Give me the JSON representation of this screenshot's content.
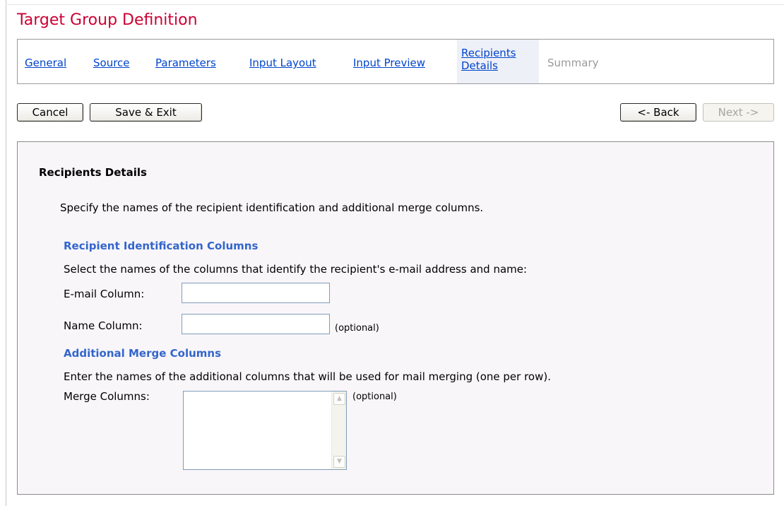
{
  "page": {
    "title": "Target Group Definition"
  },
  "tabs": [
    {
      "label": "General",
      "state": "link"
    },
    {
      "label": "Source",
      "state": "link"
    },
    {
      "label": "Parameters",
      "state": "link"
    },
    {
      "label": "Input Layout",
      "state": "link"
    },
    {
      "label": "Input Preview",
      "state": "link"
    },
    {
      "label_line1": "Recipients",
      "label_line2": "Details",
      "state": "active"
    },
    {
      "label": "Summary",
      "state": "disabled"
    }
  ],
  "toolbar": {
    "cancel_label": "Cancel",
    "save_exit_label": "Save & Exit",
    "back_label": "<- Back",
    "next_label": "Next ->"
  },
  "panel": {
    "heading": "Recipients Details",
    "intro": "Specify the names of the recipient identification and additional merge columns.",
    "identification": {
      "heading": "Recipient Identification Columns",
      "description": "Select the names of the columns that identify the recipient's e-mail address and name:",
      "email_label": "E-mail Column:",
      "email_value": "",
      "name_label": "Name Column:",
      "name_value": "",
      "name_optional": "(optional)"
    },
    "merge": {
      "heading": "Additional Merge Columns",
      "description": "Enter the names of the additional columns that will be used for mail merging (one per row).",
      "label": "Merge Columns:",
      "value": "",
      "optional": "(optional)"
    }
  },
  "icons": {
    "scroll_up": "scroll-up-arrow-icon",
    "scroll_down": "scroll-down-arrow-icon"
  },
  "colors": {
    "title": "#cc0033",
    "link": "#0044cc",
    "sub_heading": "#3366cc",
    "panel_background": "#f9f6f9",
    "disabled": "#9a9a9a"
  }
}
